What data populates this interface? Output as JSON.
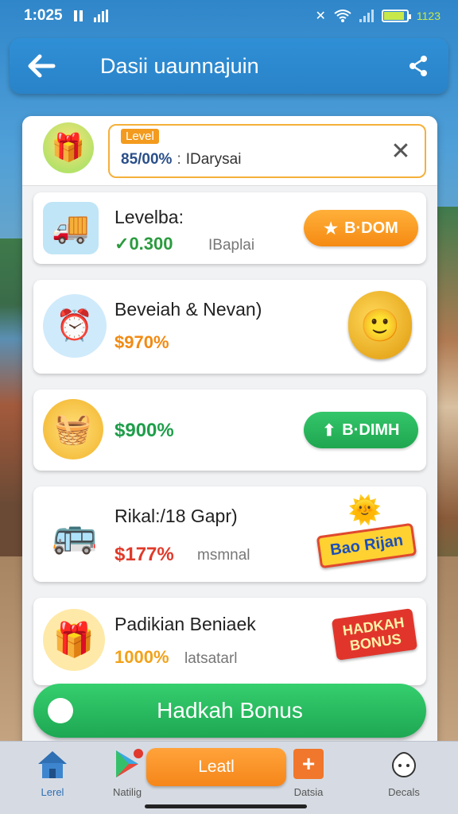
{
  "status_bar": {
    "time": "1:025",
    "battery_text": "1123",
    "battery_level": 0.9
  },
  "app_bar": {
    "title": "Dasii uaunnajuin",
    "back_icon": "back-arrow-icon",
    "share_icon": "share-icon"
  },
  "level": {
    "tag": "Level",
    "value": "85/00%",
    "separator": ":",
    "description": "IDarysai"
  },
  "cards": [
    {
      "title": "Levelba:",
      "value": "0.300",
      "value_prefix": "✓",
      "sub": "IBaplai",
      "button": "B·DOM",
      "button_icon": "star-icon",
      "value_color": "#2a9b3e"
    },
    {
      "title": "Beveiah & Nevan)",
      "value": "$970%",
      "sub": "",
      "value_color": "#f28a12"
    },
    {
      "title": "",
      "value": "$900%",
      "button": "B·DIMH",
      "button_icon": "arrow-up-icon",
      "value_color": "#1f9e4a"
    },
    {
      "title": "Rikal:/18 Gapr)",
      "value": "$177%",
      "sub": "msmnal",
      "banner": "Bao Rijan",
      "value_color": "#e03a2a"
    },
    {
      "title": "Padikian Beniaek",
      "value": "1000%",
      "sub": "latsatarl",
      "banner_line1": "HADKAH",
      "banner_line2": "BONUS",
      "value_color": "#f2a21a"
    }
  ],
  "bonus_button": "Hadkah Bonus",
  "bottom_nav": {
    "items": [
      {
        "label": "Lerel",
        "icon": "home-icon"
      },
      {
        "label": "Natilig",
        "icon": "play-store-icon"
      },
      {
        "label": "Datsia",
        "icon": "plus-icon"
      },
      {
        "label": "Decals",
        "icon": "chef-icon"
      }
    ],
    "center_button": "Leatl"
  }
}
